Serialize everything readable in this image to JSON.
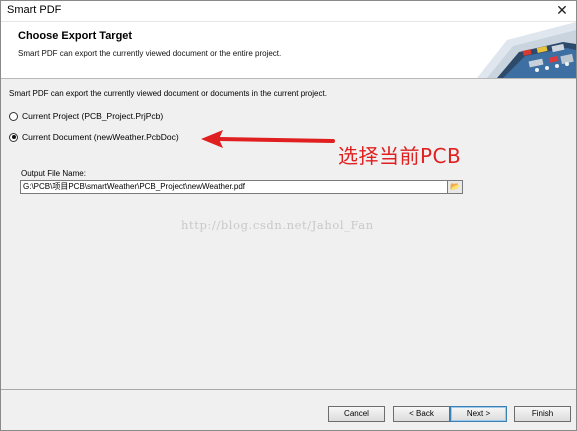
{
  "window": {
    "title": "Smart PDF"
  },
  "header": {
    "title": "Choose Export Target",
    "subtitle": "Smart PDF can export the currently viewed document or the entire project."
  },
  "main": {
    "intro": "Smart PDF can export the currently viewed document or documents in the current project.",
    "options": [
      {
        "label": "Current Project (PCB_Project.PrjPcb)",
        "checked": false
      },
      {
        "label": "Current Document (newWeather.PcbDoc)",
        "checked": true
      }
    ],
    "annotation": "选择当前PCB",
    "output_label": "Output File Name:",
    "output_value": "G:\\PCB\\项目PCB\\smartWeather\\PCB_Project\\newWeather.pdf",
    "watermark": "http://blog.csdn.net/Jahol_Fan"
  },
  "footer": {
    "cancel": "Cancel",
    "back": "< Back",
    "next": "Next >",
    "finish": "Finish"
  },
  "colors": {
    "annotation": "#e02020",
    "accent": "#3c7fb1"
  }
}
